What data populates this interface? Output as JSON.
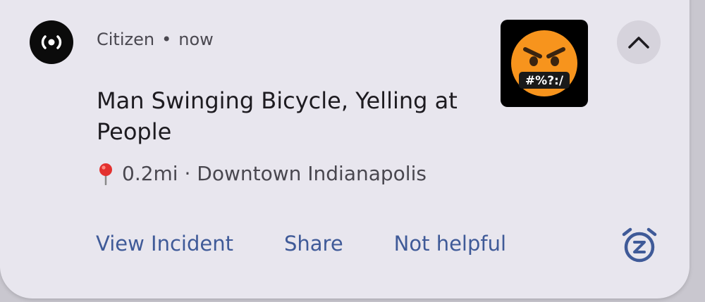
{
  "notification": {
    "app_name": "Citizen",
    "separator": "•",
    "time": "now",
    "title": "Man Swinging Bicycle, Yelling at People",
    "meta_text": "0.2mi · Downtown Indianapolis",
    "thumbnail_symbol_text": "#%?:/"
  },
  "actions": {
    "view_incident": "View Incident",
    "share": "Share",
    "not_helpful": "Not helpful"
  },
  "icons": {
    "app": "citizen-broadcast-icon",
    "pin": "location-pin-icon",
    "thumbnail": "face-with-symbols-on-mouth-emoji",
    "collapse": "chevron-up-icon",
    "snooze": "snooze-alarm-icon"
  },
  "colors": {
    "card_background": "#e8e6ee",
    "action_text": "#3f5a98",
    "title_text": "#1d1b20",
    "emoji_face": "#f7941d"
  }
}
